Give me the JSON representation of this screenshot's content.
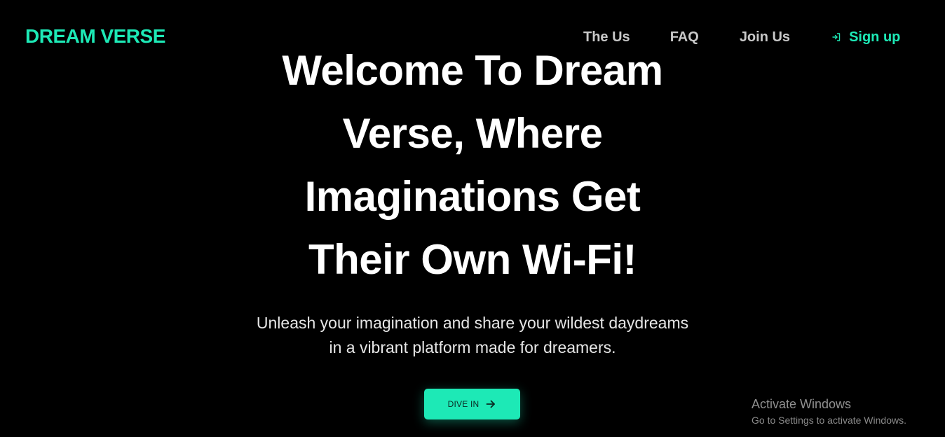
{
  "brand": {
    "name": "DREAM VERSE",
    "accent_color": "#1de9b6"
  },
  "nav": {
    "links": [
      "The Us",
      "FAQ",
      "Join Us"
    ],
    "signup_label": "Sign up",
    "signup_icon": "sign-in-icon"
  },
  "hero": {
    "title": "Welcome To Dream Verse, Where Imaginations Get Their Own Wi-Fi!",
    "subtitle": "Unleash your imagination and share your wildest daydreams in a vibrant platform made for dreamers.",
    "cta_label": "DIVE IN",
    "cta_icon": "arrow-right-icon"
  },
  "watermark": {
    "title": "Activate Windows",
    "subtitle": "Go to Settings to activate Windows."
  }
}
